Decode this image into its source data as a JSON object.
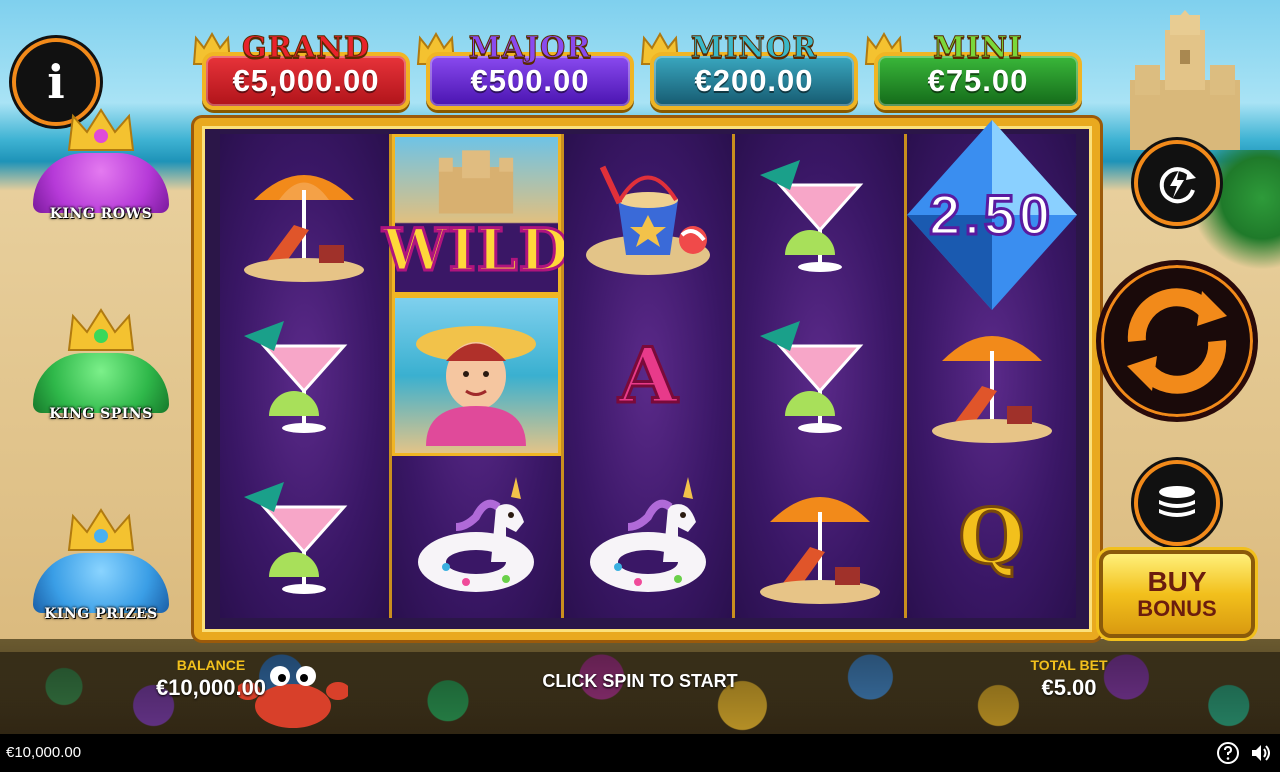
{
  "info_button": {
    "glyph": "i",
    "icon": "info-icon"
  },
  "features": [
    {
      "label": "KING ROWS",
      "gem_color": "#b63ad8"
    },
    {
      "label": "KING SPINS",
      "gem_color": "#2fb84a"
    },
    {
      "label": "KING PRIZES",
      "gem_color": "#3a9ee6"
    }
  ],
  "jackpots": [
    {
      "title": "GRAND",
      "value": "€5,000.00",
      "title_color": "#e8232a",
      "box_color": "#c4171c"
    },
    {
      "title": "MAJOR",
      "value": "€500.00",
      "title_color": "#7a3ae0",
      "box_color": "#5a1fbf"
    },
    {
      "title": "MINOR",
      "value": "€200.00",
      "title_color": "#2a9fb3",
      "box_color": "#1e6f86"
    },
    {
      "title": "MINI",
      "value": "€75.00",
      "title_color": "#6bd12f",
      "box_color": "#1f8f2a"
    }
  ],
  "reels": [
    [
      "beach-chair-umbrella",
      "cocktail",
      "cocktail"
    ],
    [
      "wild-sandcastle",
      "lady-character",
      "unicorn-float"
    ],
    [
      "sand-bucket",
      "letter-a",
      "unicorn-float"
    ],
    [
      "cocktail",
      "cocktail",
      "beach-chair-umbrella"
    ],
    [
      "diamond-multiplier",
      "beach-chair-umbrella",
      "letter-q"
    ]
  ],
  "symbols": {
    "wild_label": "WILD",
    "multiplier_value": "2.50",
    "letter_a": "A",
    "letter_q": "Q"
  },
  "controls": {
    "turbo_icon": "turbo-icon",
    "spin_icon": "spin-icon",
    "coins_icon": "coins-icon",
    "buy_bonus_line1": "BUY",
    "buy_bonus_line2": "BONUS",
    "accent_color": "#f28a1a"
  },
  "status": {
    "balance_label": "BALANCE",
    "balance_value": "€10,000.00",
    "message": "CLICK SPIN TO START",
    "total_bet_label": "TOTAL BET",
    "total_bet_value": "€5.00"
  },
  "bottom_bar": {
    "balance": "€10,000.00",
    "help_icon": "help-icon",
    "sound_icon": "sound-icon"
  }
}
